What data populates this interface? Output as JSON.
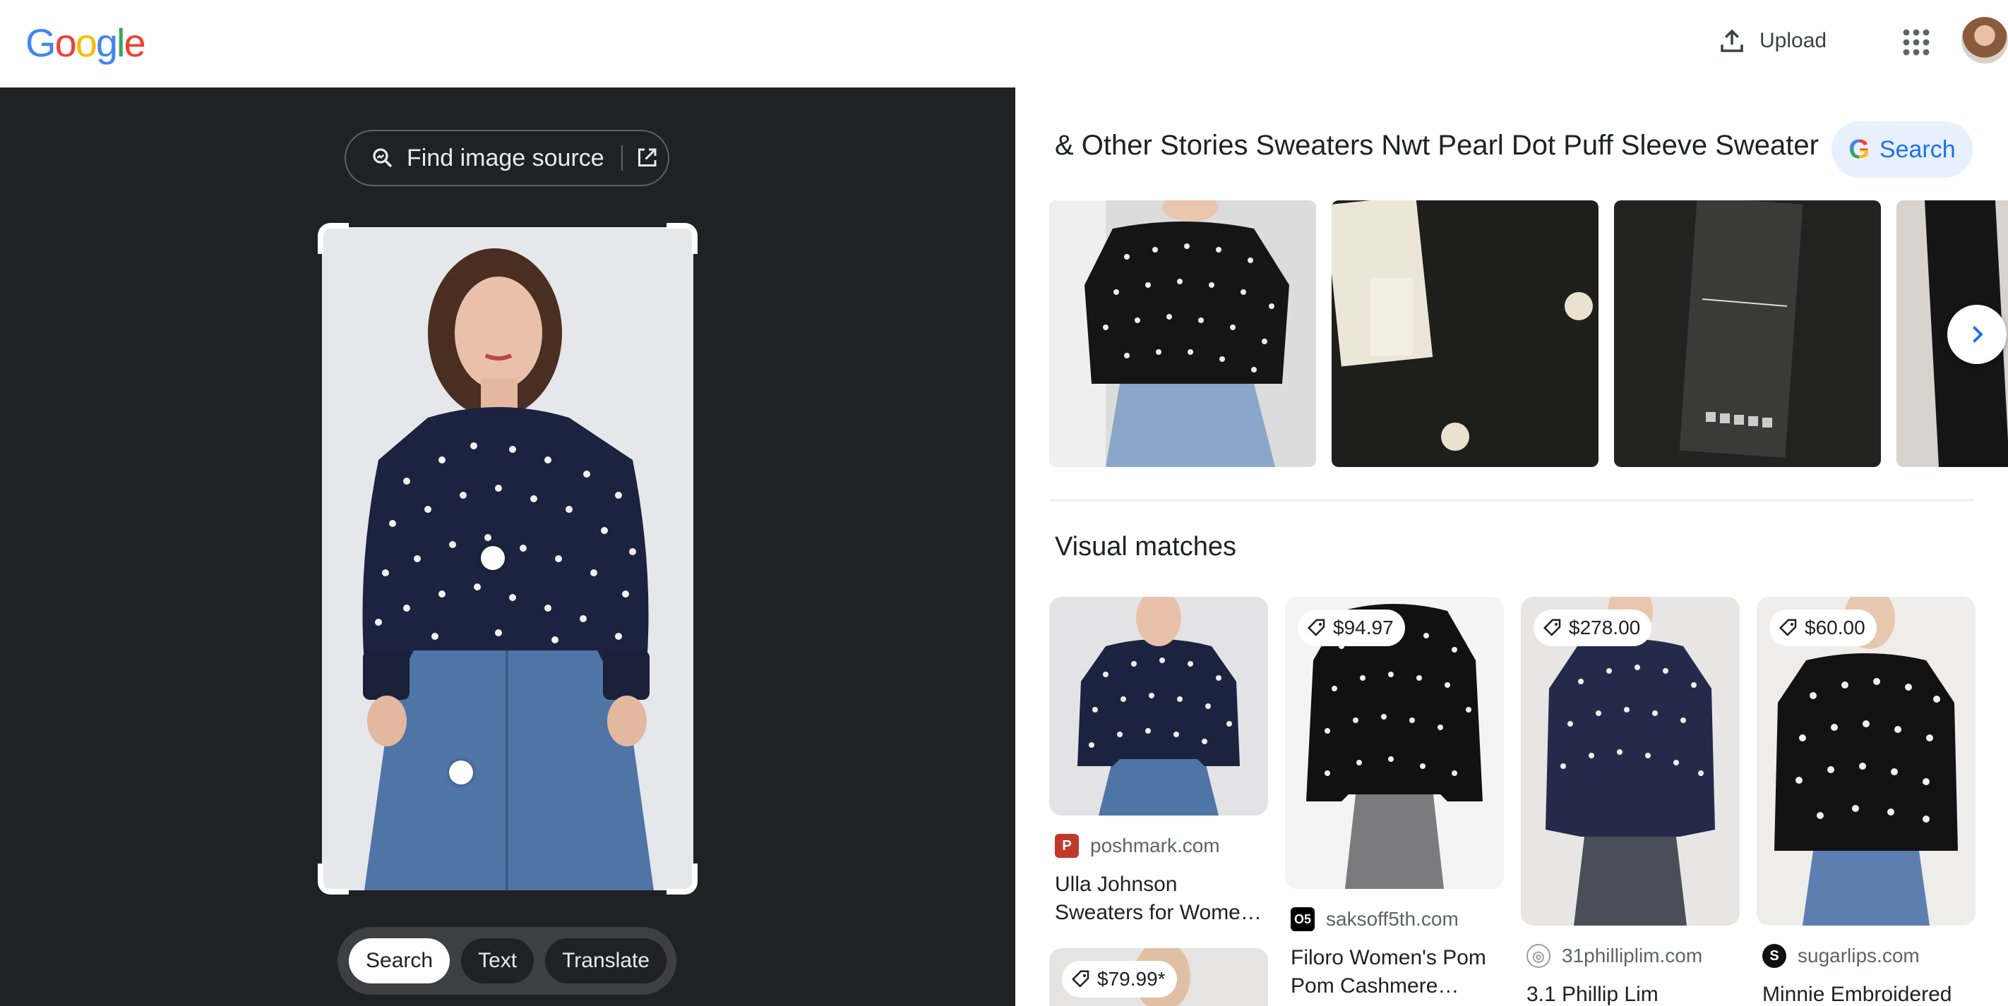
{
  "header": {
    "logo_text": "Google",
    "upload_label": "Upload",
    "apps_icon": "apps-grid-icon",
    "avatar_icon": "account-avatar"
  },
  "viewer": {
    "find_source_label": "Find image source",
    "modes": [
      "Search",
      "Text",
      "Translate"
    ],
    "active_mode": "Search"
  },
  "results": {
    "title": "& Other Stories Sweaters Nwt Pearl Dot Puff Sleeve Sweater",
    "search_label": "Search",
    "visual_matches_heading": "Visual matches",
    "matches": [
      {
        "price": "",
        "source": "poshmark.com",
        "name": "Ulla Johnson Sweaters for Women | Poshmark",
        "favicon_color": "#c0392b"
      },
      {
        "price": "$94.97",
        "source": "saksoff5th.com",
        "name": "Filoro Women's Pom Pom Cashmere Sweater",
        "favicon_color": "#000000"
      },
      {
        "price": "$278.00",
        "source": "31philliplim.com",
        "name": "3.1 Phillip Lim",
        "favicon_color": "#9aa0a6"
      },
      {
        "price": "$60.00",
        "source": "sugarlips.com",
        "name": "Minnie Embroidered",
        "favicon_color": "#111111"
      },
      {
        "price": "$79.99*",
        "source": "",
        "name": ""
      }
    ]
  },
  "colors": {
    "viewer_bg": "#202124",
    "accent_blue": "#1a73e8",
    "sweater_navy": "#1c2340"
  }
}
